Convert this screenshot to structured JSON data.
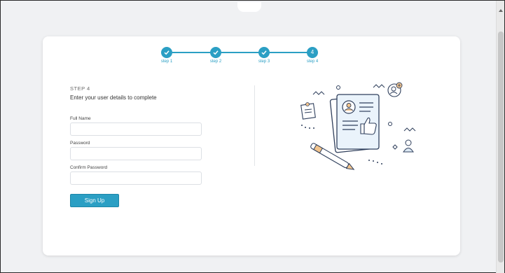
{
  "stepper": {
    "steps": [
      {
        "label": "step 1",
        "state": "done",
        "badge": ""
      },
      {
        "label": "step 2",
        "state": "done",
        "badge": ""
      },
      {
        "label": "step 3",
        "state": "done",
        "badge": ""
      },
      {
        "label": "step 4",
        "state": "current",
        "badge": "4"
      }
    ],
    "accent_color": "#2b9fc4"
  },
  "form": {
    "eyebrow": "STEP 4",
    "heading": "Enter your user details to complete",
    "fields": [
      {
        "label": "Full Name",
        "value": "",
        "placeholder": ""
      },
      {
        "label": "Password",
        "value": "",
        "placeholder": ""
      },
      {
        "label": "Confirm Password",
        "value": "",
        "placeholder": ""
      }
    ],
    "submit_label": "Sign Up"
  },
  "illustration": {
    "icon": "profile-document-illustration"
  }
}
